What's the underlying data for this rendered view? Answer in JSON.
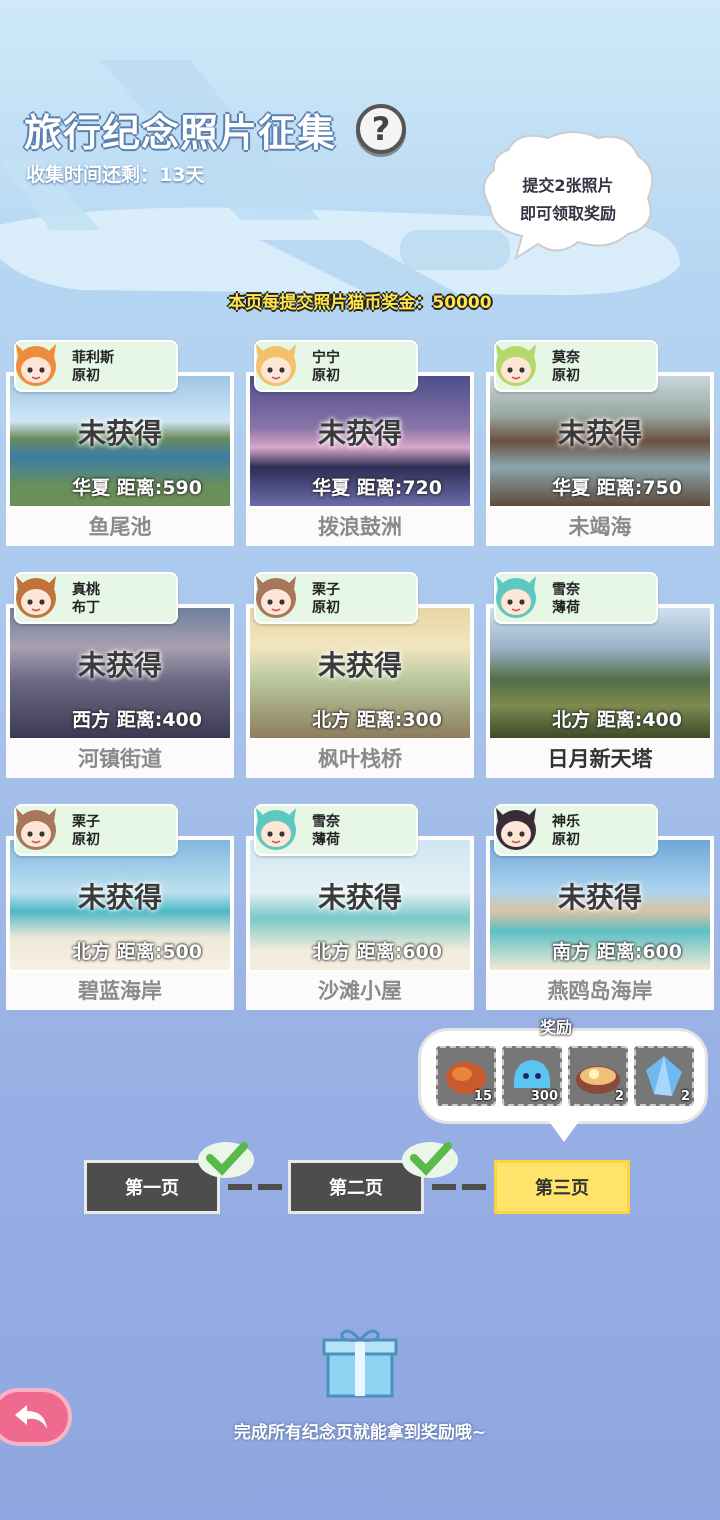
{
  "header": {
    "title": "旅行纪念照片征集",
    "help_label": "?",
    "countdown": "收集时间还剩：13天",
    "bubble_line1": "提交2张照片",
    "bubble_line2": "即可领取奖励",
    "bonus": "本页每提交照片猫币奖金：50000"
  },
  "cards": [
    {
      "char_name": "菲利斯",
      "char_outfit": "原初",
      "status": "未获得",
      "location": "华夏  距离:590",
      "place": "鱼尾池"
    },
    {
      "char_name": "宁宁",
      "char_outfit": "原初",
      "status": "未获得",
      "location": "华夏  距离:720",
      "place": "拨浪鼓洲"
    },
    {
      "char_name": "莫奈",
      "char_outfit": "原初",
      "status": "未获得",
      "location": "华夏  距离:750",
      "place": "未竭海"
    },
    {
      "char_name": "真桃",
      "char_outfit": "布丁",
      "status": "未获得",
      "location": "西方  距离:400",
      "place": "河镇街道"
    },
    {
      "char_name": "栗子",
      "char_outfit": "原初",
      "status": "未获得",
      "location": "北方  距离:300",
      "place": "枫叶栈桥"
    },
    {
      "char_name": "雪奈",
      "char_outfit": "薄荷",
      "status": "",
      "location": "北方  距离:400",
      "place": "日月新天塔"
    },
    {
      "char_name": "栗子",
      "char_outfit": "原初",
      "status": "未获得",
      "location": "北方  距离:500",
      "place": "碧蓝海岸"
    },
    {
      "char_name": "雪奈",
      "char_outfit": "薄荷",
      "status": "未获得",
      "location": "北方  距离:600",
      "place": "沙滩小屋"
    },
    {
      "char_name": "神乐",
      "char_outfit": "原初",
      "status": "未获得",
      "location": "南方  距离:600",
      "place": "燕鸥岛海岸"
    }
  ],
  "reward": {
    "title": "奖励",
    "items": [
      {
        "icon": "meat-icon",
        "qty": "15"
      },
      {
        "icon": "slime-icon",
        "qty": "300"
      },
      {
        "icon": "ramen-icon",
        "qty": "2"
      },
      {
        "icon": "crystal-icon",
        "qty": "2"
      }
    ]
  },
  "pages": [
    {
      "label": "第一页",
      "done": true
    },
    {
      "label": "第二页",
      "done": true
    },
    {
      "label": "第三页",
      "done": false
    }
  ],
  "footer": "完成所有纪念页就能拿到奖励哦~",
  "colors": {
    "active_page": "#ffe46b",
    "page_bg": "#4d4d4d",
    "tag_bg": "#e6f7e5",
    "back_button": "#ef6a8e"
  }
}
